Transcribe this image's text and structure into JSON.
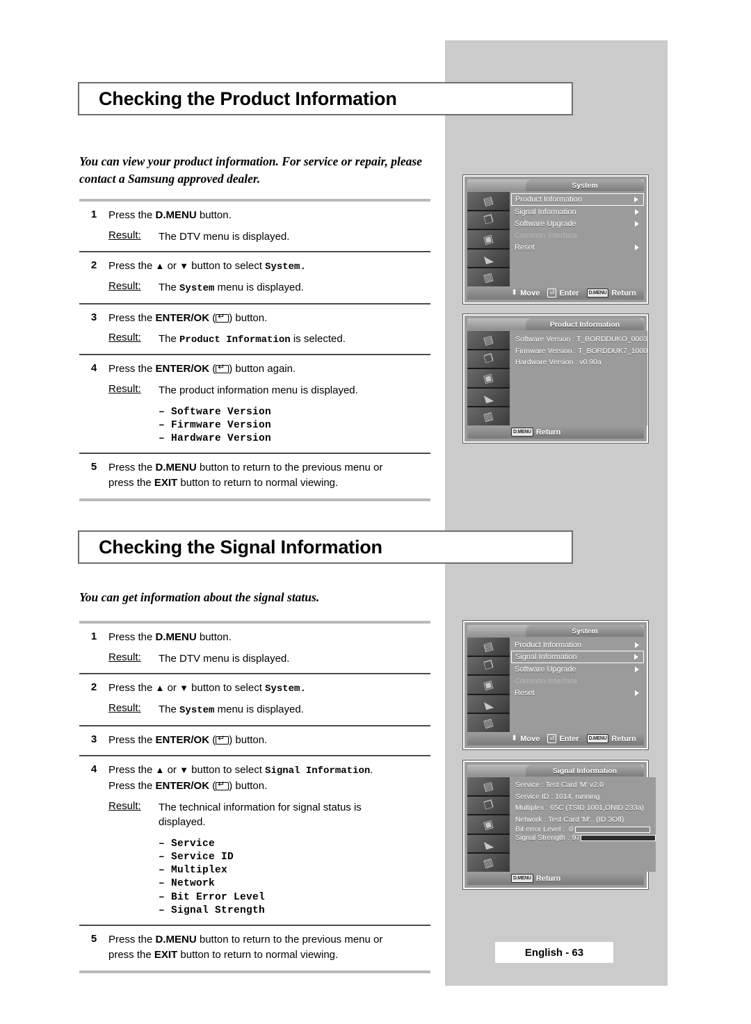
{
  "page": {
    "footer_label": "English - 63"
  },
  "sections": [
    {
      "header": "Checking the Product Information",
      "intro": "You can view your product information. For service or repair, please contact a Samsung approved dealer.",
      "steps": [
        {
          "num": "1",
          "lines": [
            "Press the D.MENU button."
          ],
          "result_label": "Result:",
          "result_text": "The DTV menu is displayed."
        },
        {
          "num": "2",
          "lines": [
            "Press the ▲ or ▼ button to select System."
          ],
          "result_label": "Result:",
          "result_text": "The System menu is displayed."
        },
        {
          "num": "3",
          "lines": [
            "Press the ENTER/OK (⏎) button."
          ],
          "result_label": "Result:",
          "result_text": "The Product Information is selected."
        },
        {
          "num": "4",
          "lines": [
            "Press the ENTER/OK (⏎) button again."
          ],
          "result_label": "Result:",
          "result_text": "The product information menu is displayed.",
          "bullets": [
            "– Software Version",
            "– Firmware Version",
            "– Hardware Version"
          ]
        },
        {
          "num": "5",
          "lines": [
            "Press the D.MENU button to return to the previous menu or",
            "press the EXIT button to return to normal viewing."
          ]
        }
      ]
    },
    {
      "header": "Checking the Signal Information",
      "intro": "You can get information about the signal status.",
      "steps": [
        {
          "num": "1",
          "lines": [
            "Press the D.MENU button."
          ],
          "result_label": "Result:",
          "result_text": "The DTV menu is displayed."
        },
        {
          "num": "2",
          "lines": [
            "Press the ▲ or ▼ button to select System."
          ],
          "result_label": "Result:",
          "result_text": "The System menu is displayed."
        },
        {
          "num": "3",
          "lines": [
            "Press the ENTER/OK (⏎) button."
          ]
        },
        {
          "num": "4",
          "lines": [
            "Press the ▲ or ▼ button to select Signal Information.",
            "Press the ENTER/OK (⏎) button."
          ],
          "result_label": "Result:",
          "result_text": "The technical information for signal status is displayed.",
          "bullets": [
            "– Service",
            "– Service ID",
            "– Multiplex",
            "– Network",
            "– Bit Error Level",
            "– Signal Strength"
          ]
        },
        {
          "num": "5",
          "lines": [
            "Press the D.MENU button to return to the previous menu or",
            "press the EXIT button to return to normal viewing."
          ]
        }
      ]
    }
  ],
  "osd": {
    "system_menu_1": {
      "title": "System",
      "items": [
        {
          "label": "Product Information",
          "selected": true,
          "dim": false,
          "carat": true
        },
        {
          "label": "Signal Information",
          "selected": false,
          "dim": false,
          "carat": true
        },
        {
          "label": "Software Upgrade",
          "selected": false,
          "dim": false,
          "carat": true
        },
        {
          "label": "Common Interface",
          "selected": false,
          "dim": true,
          "carat": false
        },
        {
          "label": "Reset",
          "selected": false,
          "dim": false,
          "carat": true
        }
      ],
      "footer": [
        {
          "key": "⬍",
          "label": "Move"
        },
        {
          "key": "⏎",
          "label": "Enter"
        },
        {
          "key": "D.MENU",
          "label": "Return"
        }
      ]
    },
    "product_information": {
      "title": "Product Information",
      "lines": [
        "Software Version : T_BORDDUKO_0003",
        "Firmware Version : T_BORDDUK7_1000",
        "Hardware Version : v0.90a"
      ],
      "footer": [
        {
          "key": "D.MENU",
          "label": "Return"
        }
      ]
    },
    "system_menu_2": {
      "title": "System",
      "items": [
        {
          "label": "Product Information",
          "selected": false,
          "dim": false,
          "carat": true
        },
        {
          "label": "Signal Information",
          "selected": true,
          "dim": false,
          "carat": true
        },
        {
          "label": "Software Upgrade",
          "selected": false,
          "dim": false,
          "carat": true
        },
        {
          "label": "Common Interface",
          "selected": false,
          "dim": true,
          "carat": false
        },
        {
          "label": "Reset",
          "selected": false,
          "dim": false,
          "carat": true
        }
      ],
      "footer": [
        {
          "key": "⬍",
          "label": "Move"
        },
        {
          "key": "⏎",
          "label": "Enter"
        },
        {
          "key": "D.MENU",
          "label": "Return"
        }
      ]
    },
    "signal_information": {
      "title": "Signal Information",
      "lines": [
        "Service : Test Card 'M' v2.0",
        "Service ID : 1014, running",
        "Multiplex : 65C (TSID 1001,ONID 233a)",
        "Network : Test Card 'M'.. (ID 3Off)"
      ],
      "meters": [
        {
          "label": "Bit error Level :",
          "value": "0",
          "fill": 0
        },
        {
          "label": "Signal Strength :",
          "value": "97",
          "fill": 100
        }
      ],
      "footer": [
        {
          "key": "D.MENU",
          "label": "Return"
        }
      ]
    }
  }
}
